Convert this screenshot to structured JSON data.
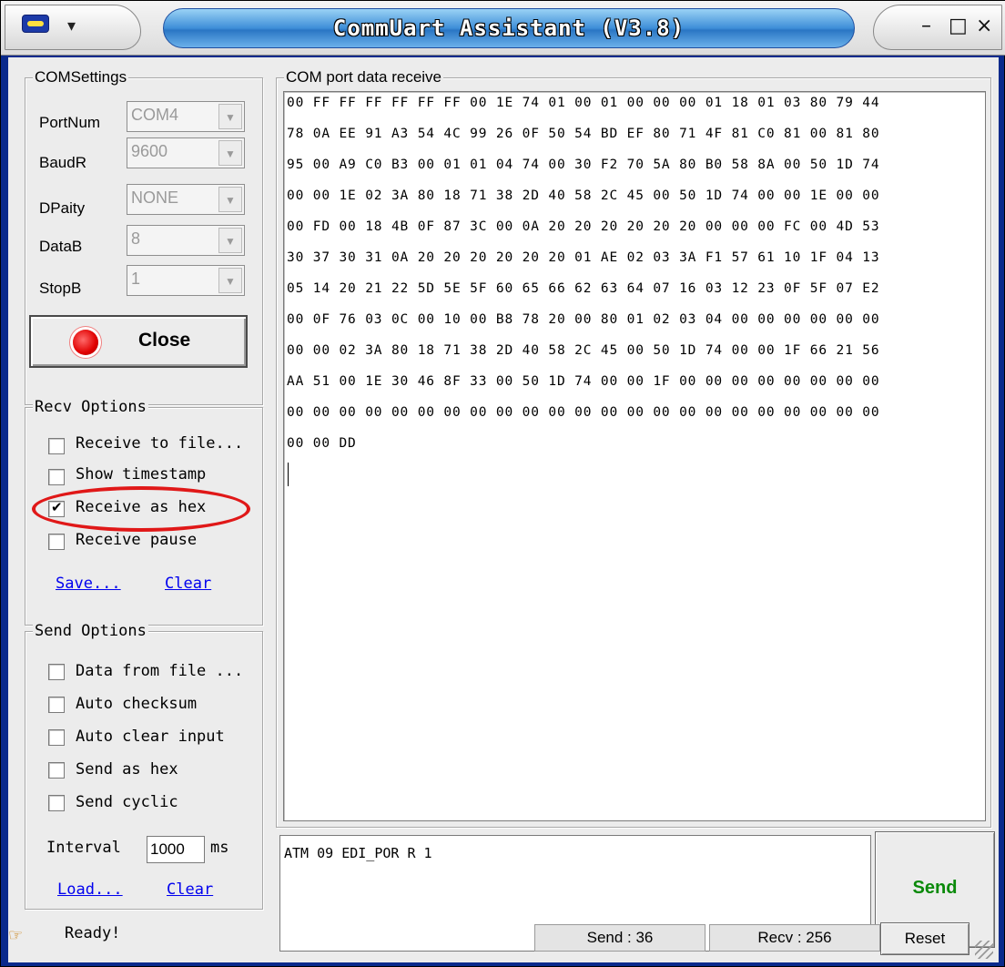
{
  "window": {
    "title": "CommUart Assistant (V3.8)",
    "minimize_glyph": "–",
    "maximize_glyph": "□",
    "close_glyph": "×",
    "menu_arrow_glyph": "▾"
  },
  "com_settings": {
    "legend": "COMSettings",
    "fields": [
      {
        "label": "PortNum",
        "value": "COM4"
      },
      {
        "label": "BaudR",
        "value": "9600"
      },
      {
        "label": "DPaity",
        "value": "NONE"
      },
      {
        "label": "DataB",
        "value": "8"
      },
      {
        "label": "StopB",
        "value": "1"
      }
    ],
    "close_button": "Close"
  },
  "recv_options": {
    "legend": "Recv Options",
    "checkboxes": [
      {
        "label": "Receive to file...",
        "checked": false
      },
      {
        "label": "Show timestamp",
        "checked": false
      },
      {
        "label": "Receive as hex",
        "checked": true
      },
      {
        "label": "Receive pause",
        "checked": false
      }
    ],
    "save_link": "Save...",
    "clear_link": "Clear"
  },
  "send_options": {
    "legend": "Send Options",
    "checkboxes": [
      {
        "label": "Data from file ...",
        "checked": false
      },
      {
        "label": "Auto checksum",
        "checked": false
      },
      {
        "label": "Auto clear input",
        "checked": false
      },
      {
        "label": "Send as hex",
        "checked": false
      },
      {
        "label": "Send cyclic",
        "checked": false
      }
    ],
    "interval_label": "Interval",
    "interval_value": "1000",
    "interval_unit": "ms",
    "load_link": "Load...",
    "clear_link": "Clear"
  },
  "receive_panel": {
    "legend": "COM port data receive",
    "lines": [
      "00 FF FF FF FF FF FF 00 1E 74 01 00 01 00 00 00 01 18 01 03 80 79 44",
      "78 0A EE 91 A3 54 4C 99 26 0F 50 54 BD EF 80 71 4F 81 C0 81 00 81 80",
      "95 00 A9 C0 B3 00 01 01 04 74 00 30 F2 70 5A 80 B0 58 8A 00 50 1D 74",
      "00 00 1E 02 3A 80 18 71 38 2D 40 58 2C 45 00 50 1D 74 00 00 1E 00 00",
      "00 FD 00 18 4B 0F 87 3C 00 0A 20 20 20 20 20 20 00 00 00 FC 00 4D 53",
      "30 37 30 31 0A 20 20 20 20 20 20 01 AE 02 03 3A F1 57 61 10 1F 04 13",
      "05 14 20 21 22 5D 5E 5F 60 65 66 62 63 64 07 16 03 12 23 0F 5F 07 E2",
      "00 0F 76 03 0C 00 10 00 B8 78 20 00 80 01 02 03 04 00 00 00 00 00 00",
      "00 00 02 3A 80 18 71 38 2D 40 58 2C 45 00 50 1D 74 00 00 1F 66 21 56",
      "AA 51 00 1E 30 46 8F 33 00 50 1D 74 00 00 1F 00 00 00 00 00 00 00 00",
      "00 00 00 00 00 00 00 00 00 00 00 00 00 00 00 00 00 00 00 00 00 00 00",
      "00 00 DD"
    ]
  },
  "send_panel": {
    "input_value": "ATM 09 EDI_POR R 1",
    "send_button": "Send"
  },
  "status": {
    "icon": "hand-icon",
    "text": "Ready!",
    "send_count": "Send : 36",
    "recv_count": "Recv : 256",
    "reset_button": "Reset"
  },
  "colors": {
    "title_bar_accent": "#3e8ed8",
    "send_button_text": "#0a8a0a",
    "close_indicator": "#e00000",
    "highlight_ellipse": "#e01818",
    "link": "#0000ee"
  }
}
